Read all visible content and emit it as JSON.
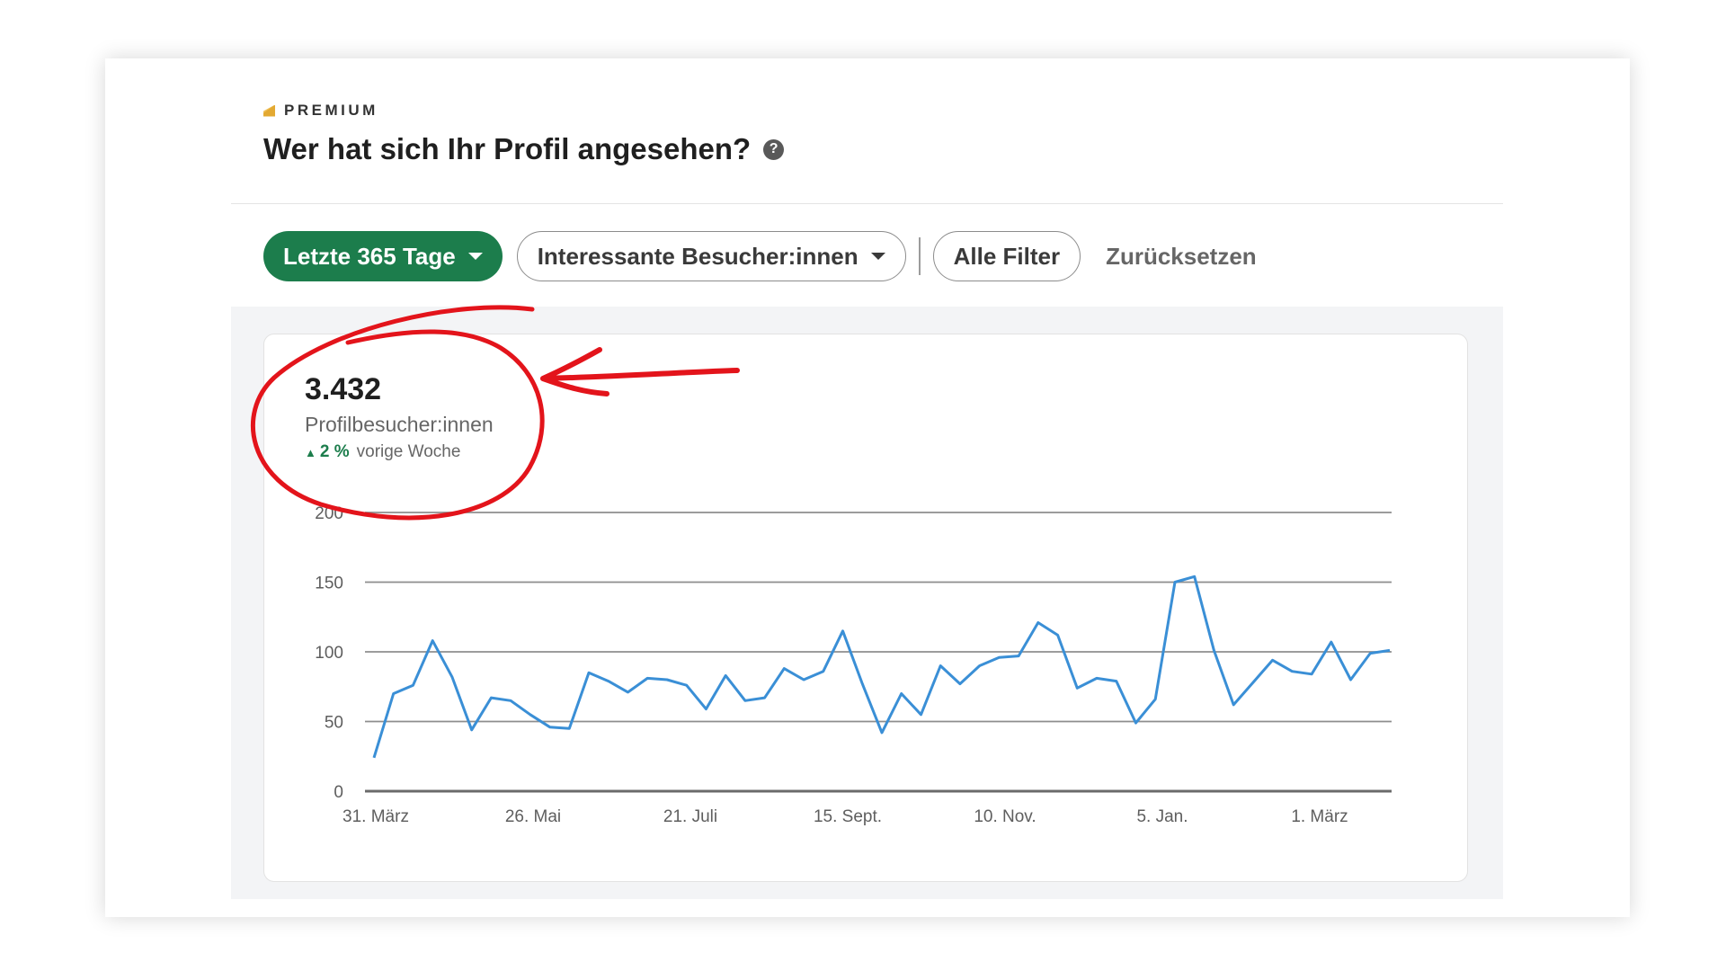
{
  "header": {
    "premium_label": "PREMIUM",
    "title": "Wer hat sich Ihr Profil angesehen?"
  },
  "filters": {
    "time_range": "Letzte 365 Tage",
    "visitor_type": "Interessante Besucher:innen",
    "all_filters": "Alle Filter",
    "reset": "Zurücksetzen"
  },
  "metric": {
    "value": "3.432",
    "label": "Profilbesucher:innen",
    "change": "2 %",
    "change_period": "vorige Woche"
  },
  "colors": {
    "primary_green": "#1c7d4c",
    "line_blue": "#3a8fd6",
    "annotation_red": "#e3141b",
    "premium_gold": "#e3a932"
  },
  "chart_data": {
    "type": "line",
    "ylim": [
      0,
      200
    ],
    "y_ticks": [
      0,
      50,
      100,
      150,
      200
    ],
    "x_tick_labels": [
      "31. März",
      "26. Mai",
      "21. Juli",
      "15. Sept.",
      "10. Nov.",
      "5. Jan.",
      "1. März"
    ],
    "series": [
      {
        "values": [
          24,
          70,
          76,
          108,
          82,
          44,
          67,
          65,
          55,
          46,
          45,
          85,
          79,
          71,
          81,
          80,
          76,
          59,
          83,
          65,
          67,
          88,
          80,
          86,
          115,
          77,
          42,
          70,
          55,
          90,
          77,
          90,
          96,
          97,
          121,
          112,
          74,
          81,
          79,
          49,
          66,
          150,
          154,
          101,
          62,
          78,
          94,
          86,
          84,
          107,
          80,
          99,
          101
        ]
      }
    ],
    "grid": true
  }
}
